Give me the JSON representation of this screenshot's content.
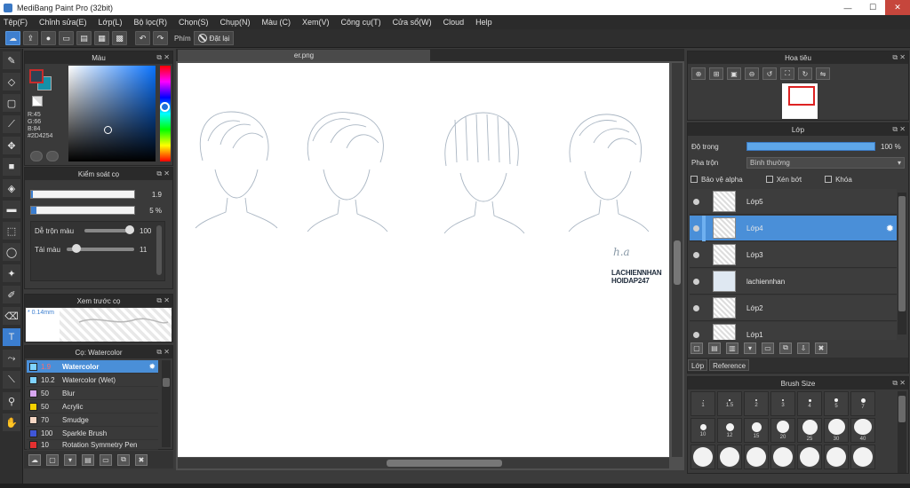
{
  "window": {
    "title": "MediBang Paint Pro (32bit)",
    "minimize": "—",
    "maximize": "☐",
    "close": "✕"
  },
  "menu": [
    "Tệp(F)",
    "Chỉnh sửa(E)",
    "Lớp(L)",
    "Bộ lọc(R)",
    "Chọn(S)",
    "Chụp(N)",
    "Màu (C)",
    "Xem(V)",
    "Công cụ(T)",
    "Cửa sổ(W)",
    "Cloud",
    "Help"
  ],
  "toolbar": {
    "key_label": "Phím",
    "reset_label": "Đặt lại"
  },
  "color_panel": {
    "title": "Màu",
    "fg_color": "#2D4254",
    "bg_color": "#1590A8",
    "r": "R:45",
    "g": "G:66",
    "b": "B:84",
    "hex": "#2D4254"
  },
  "brush_control": {
    "title": "Kiểm soát cọ",
    "size_value": "1.9",
    "size_fraction": 0.02,
    "opacity_value": "5 %",
    "opacity_fraction": 0.05,
    "blend_label": "Dễ trộn màu",
    "blend_value": "100",
    "paint_label": "Tải màu",
    "paint_value": "11"
  },
  "brush_preview": {
    "title": "Xem trước cọ",
    "size_text": "* 0.14mm"
  },
  "brush_list": {
    "title": "Cọ: Watercolor",
    "items": [
      {
        "size": "1.9",
        "name": "Watercolor",
        "color": "#7fd3ff",
        "selected": true
      },
      {
        "size": "10.2",
        "name": "Watercolor (Wet)",
        "color": "#7fd3ff"
      },
      {
        "size": "50",
        "name": "Blur",
        "color": "#d7a6f0"
      },
      {
        "size": "50",
        "name": "Acrylic",
        "color": "#f5d100"
      },
      {
        "size": "70",
        "name": "Smudge",
        "color": "#f7d7c4"
      },
      {
        "size": "100",
        "name": "Sparkle Brush",
        "color": "#3f56d8"
      },
      {
        "size": "10",
        "name": "Rotation Symmetry Pen",
        "color": "#e43030"
      }
    ]
  },
  "document": {
    "tab": "er.png",
    "signature": "h.a",
    "watermark_line1": "LACHIENNHAN",
    "watermark_line2": "HOIDAP247"
  },
  "navigator": {
    "title": "Hoa tiêu"
  },
  "layer_panel": {
    "title": "Lớp",
    "opacity_label": "Độ trong",
    "opacity_value": "100 %",
    "blend_label": "Pha trộn",
    "blend_value": "Bình thường",
    "protect_alpha": "Bảo vệ alpha",
    "clipping": "Xén bớt",
    "lock": "Khóa",
    "layers": [
      {
        "name": "Lớp5"
      },
      {
        "name": "Lớp4",
        "selected": true
      },
      {
        "name": "Lớp3"
      },
      {
        "name": "lachiennhan"
      },
      {
        "name": "Lớp2"
      },
      {
        "name": "Lớp1"
      }
    ],
    "tab_layer": "Lớp",
    "tab_reference": "Reference"
  },
  "brush_size": {
    "title": "Brush Size",
    "row1": [
      "1",
      "1.5",
      "2",
      "3",
      "4",
      "5",
      "7"
    ],
    "row2": [
      "10",
      "12",
      "15",
      "20",
      "25",
      "30",
      "40"
    ]
  }
}
